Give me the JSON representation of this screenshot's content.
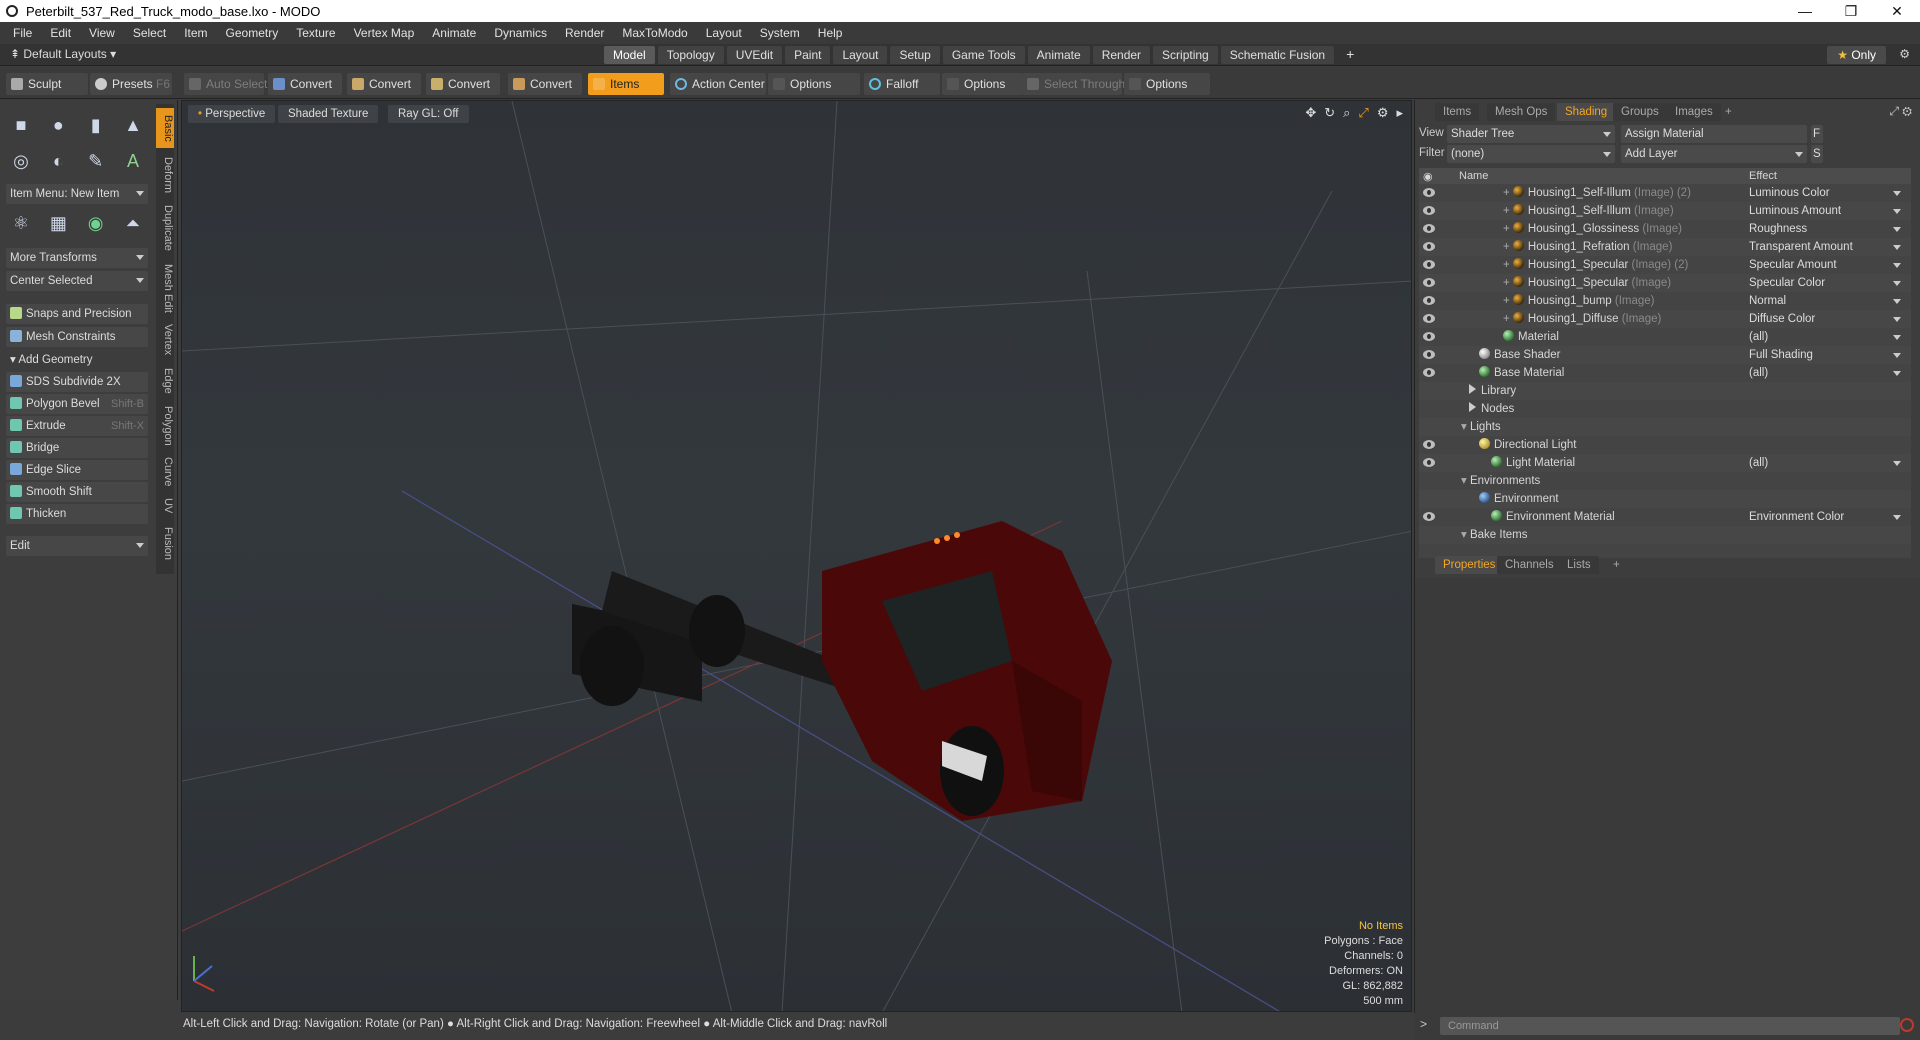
{
  "window": {
    "title": "Peterbilt_537_Red_Truck_modo_base.lxo - MODO",
    "controls": [
      "—",
      "❐",
      "✕"
    ]
  },
  "menu": [
    "File",
    "Edit",
    "View",
    "Select",
    "Item",
    "Geometry",
    "Texture",
    "Vertex Map",
    "Animate",
    "Dynamics",
    "Render",
    "MaxToModo",
    "Layout",
    "System",
    "Help"
  ],
  "layouts_label": "Default Layouts",
  "mode_tabs": [
    "Model",
    "Topology",
    "UVEdit",
    "Paint",
    "Layout",
    "Setup",
    "Game Tools",
    "Animate",
    "Render",
    "Scripting",
    "Schematic Fusion"
  ],
  "active_mode_tab": "Model",
  "add_tab": "+",
  "only_label": "Only",
  "toolbar": {
    "sculpt": "Sculpt",
    "presets": "Presets",
    "presets_key": "F6",
    "auto_select": "Auto Select",
    "convert1": "Convert",
    "convert2": "Convert",
    "convert3": "Convert",
    "convert4": "Convert",
    "items": "Items",
    "action_center": "Action Center",
    "options1": "Options",
    "falloff": "Falloff",
    "options2": "Options",
    "select_through": "Select Through",
    "options3": "Options"
  },
  "left_vtabs": [
    "Basic",
    "Deform",
    "Duplicate",
    "Mesh Edit",
    "Vertex",
    "Edge",
    "Polygon",
    "Curve",
    "UV",
    "Fusion"
  ],
  "left_panel": {
    "item_menu": "Item Menu: New Item",
    "more_transforms": "More Transforms",
    "center_selected": "Center Selected",
    "snaps": "Snaps and Precision",
    "constraints": "Mesh Constraints",
    "add_geometry": "Add Geometry",
    "tools": [
      {
        "label": "SDS Subdivide 2X",
        "key": ""
      },
      {
        "label": "Polygon Bevel",
        "key": "Shift-B"
      },
      {
        "label": "Extrude",
        "key": "Shift-X"
      },
      {
        "label": "Bridge",
        "key": ""
      },
      {
        "label": "Edge Slice",
        "key": ""
      },
      {
        "label": "Smooth Shift",
        "key": ""
      },
      {
        "label": "Thicken",
        "key": ""
      }
    ],
    "edit_dropdown": "Edit"
  },
  "viewport": {
    "view": "Perspective",
    "shading": "Shaded Texture",
    "raygl": "Ray GL: Off",
    "stats": {
      "no_items": "No Items",
      "polygons": "Polygons : Face",
      "channels": "Channels: 0",
      "deformers": "Deformers: ON",
      "gl": "GL: 862,882",
      "size": "500 mm"
    }
  },
  "statusbar": "Alt-Left Click and Drag: Navigation: Rotate (or Pan) ● Alt-Right Click and Drag: Navigation: Freewheel ● Alt-Middle Click and Drag: navRoll",
  "right_panel": {
    "tabs": [
      "Items",
      "Mesh Ops",
      "Shading",
      "Groups",
      "Images"
    ],
    "active_tab": "Shading",
    "view_label": "View",
    "view_value": "Shader Tree",
    "assign_material": "Assign Material",
    "filter_label": "Filter",
    "filter_value": "(none)",
    "add_layer": "Add Layer",
    "col_name": "Name",
    "col_effect": "Effect",
    "rows": [
      {
        "name": "Housing1_Self-Illum",
        "sub": "(Image) (2)",
        "effect": "Luminous Color",
        "icon": "img",
        "indent": 84,
        "eye": true,
        "plus": true
      },
      {
        "name": "Housing1_Self-Illum",
        "sub": "(Image)",
        "effect": "Luminous Amount",
        "icon": "img",
        "indent": 84,
        "eye": true,
        "plus": true
      },
      {
        "name": "Housing1_Glossiness",
        "sub": "(Image)",
        "effect": "Roughness",
        "icon": "img",
        "indent": 84,
        "eye": true,
        "plus": true
      },
      {
        "name": "Housing1_Refration",
        "sub": "(Image)",
        "effect": "Transparent Amount",
        "icon": "img",
        "indent": 84,
        "eye": true,
        "plus": true
      },
      {
        "name": "Housing1_Specular",
        "sub": "(Image) (2)",
        "effect": "Specular Amount",
        "icon": "img",
        "indent": 84,
        "eye": true,
        "plus": true
      },
      {
        "name": "Housing1_Specular",
        "sub": "(Image)",
        "effect": "Specular Color",
        "icon": "img",
        "indent": 84,
        "eye": true,
        "plus": true
      },
      {
        "name": "Housing1_bump",
        "sub": "(Image)",
        "effect": "Normal",
        "icon": "img",
        "indent": 84,
        "eye": true,
        "plus": true
      },
      {
        "name": "Housing1_Diffuse",
        "sub": "(Image)",
        "effect": "Diffuse Color",
        "icon": "img",
        "indent": 84,
        "eye": true,
        "plus": true
      },
      {
        "name": "Material",
        "sub": "",
        "effect": "(all)",
        "icon": "mat",
        "indent": 84,
        "eye": true,
        "plus": false
      },
      {
        "name": "Base Shader",
        "sub": "",
        "effect": "Full Shading",
        "icon": "shd",
        "indent": 60,
        "eye": true,
        "plus": false
      },
      {
        "name": "Base Material",
        "sub": "",
        "effect": "(all)",
        "icon": "mat",
        "indent": 60,
        "eye": true,
        "plus": false
      },
      {
        "name": "Library",
        "sub": "",
        "effect": "",
        "icon": "folder",
        "indent": 50,
        "eye": false,
        "plus": false
      },
      {
        "name": "Nodes",
        "sub": "",
        "effect": "",
        "icon": "folder",
        "indent": 50,
        "eye": false,
        "plus": false
      },
      {
        "name": "Lights",
        "sub": "",
        "effect": "",
        "icon": "none",
        "indent": 42,
        "eye": false,
        "plus": false
      },
      {
        "name": "Directional Light",
        "sub": "",
        "effect": "",
        "icon": "lit",
        "indent": 60,
        "eye": true,
        "plus": false
      },
      {
        "name": "Light Material",
        "sub": "",
        "effect": "(all)",
        "icon": "mat",
        "indent": 72,
        "eye": true,
        "plus": false
      },
      {
        "name": "Environments",
        "sub": "",
        "effect": "",
        "icon": "none",
        "indent": 42,
        "eye": false,
        "plus": false
      },
      {
        "name": "Environment",
        "sub": "",
        "effect": "",
        "icon": "env",
        "indent": 60,
        "eye": false,
        "plus": false
      },
      {
        "name": "Environment Material",
        "sub": "",
        "effect": "Environment Color",
        "icon": "mat",
        "indent": 72,
        "eye": true,
        "plus": false
      },
      {
        "name": "Bake Items",
        "sub": "",
        "effect": "",
        "icon": "none",
        "indent": 42,
        "eye": false,
        "plus": false
      }
    ],
    "bottom_tabs": [
      "Properties",
      "Channels",
      "Lists"
    ],
    "active_bottom_tab": "Properties",
    "command_placeholder": "Command"
  },
  "colors": {
    "accent": "#f29d1c",
    "truck_body": "#5a0a0a"
  }
}
